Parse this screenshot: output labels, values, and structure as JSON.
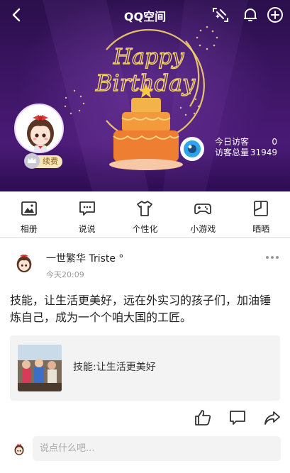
{
  "header": {
    "title": "QQ空间",
    "back_icon": "chevron-left-icon",
    "right_icons": [
      "sparkle-edit-icon",
      "bell-icon",
      "plus-circle-icon"
    ]
  },
  "banner": {
    "art_text": [
      "Happy",
      "Birthday"
    ],
    "badge_label": "续费",
    "visitors": {
      "today_label": "今日访客",
      "today_count": "0",
      "total_label": "访客总量",
      "total_count": "31949"
    }
  },
  "features": [
    {
      "label": "相册",
      "icon": "photo-album-icon"
    },
    {
      "label": "说说",
      "icon": "chat-bubble-icon"
    },
    {
      "label": "个性化",
      "icon": "tshirt-icon"
    },
    {
      "label": "小游戏",
      "icon": "gamepad-icon"
    },
    {
      "label": "晒晒",
      "icon": "share-frame-icon"
    }
  ],
  "post": {
    "author": "一世繁华 Triste °",
    "time": "今天20:09",
    "text": "技能，让生活更美好，远在外实习的孩子们，加油锤炼自己，成为一个个咱大国的工匠。",
    "share_title": "技能:让生活更美好",
    "actions": [
      "like-icon",
      "comment-icon",
      "forward-icon"
    ],
    "comment_placeholder": "说点什么吧..."
  },
  "colors": {
    "banner_bg": "#3b1563",
    "cake": "#f28a3a",
    "gold": "#f6d36b"
  }
}
